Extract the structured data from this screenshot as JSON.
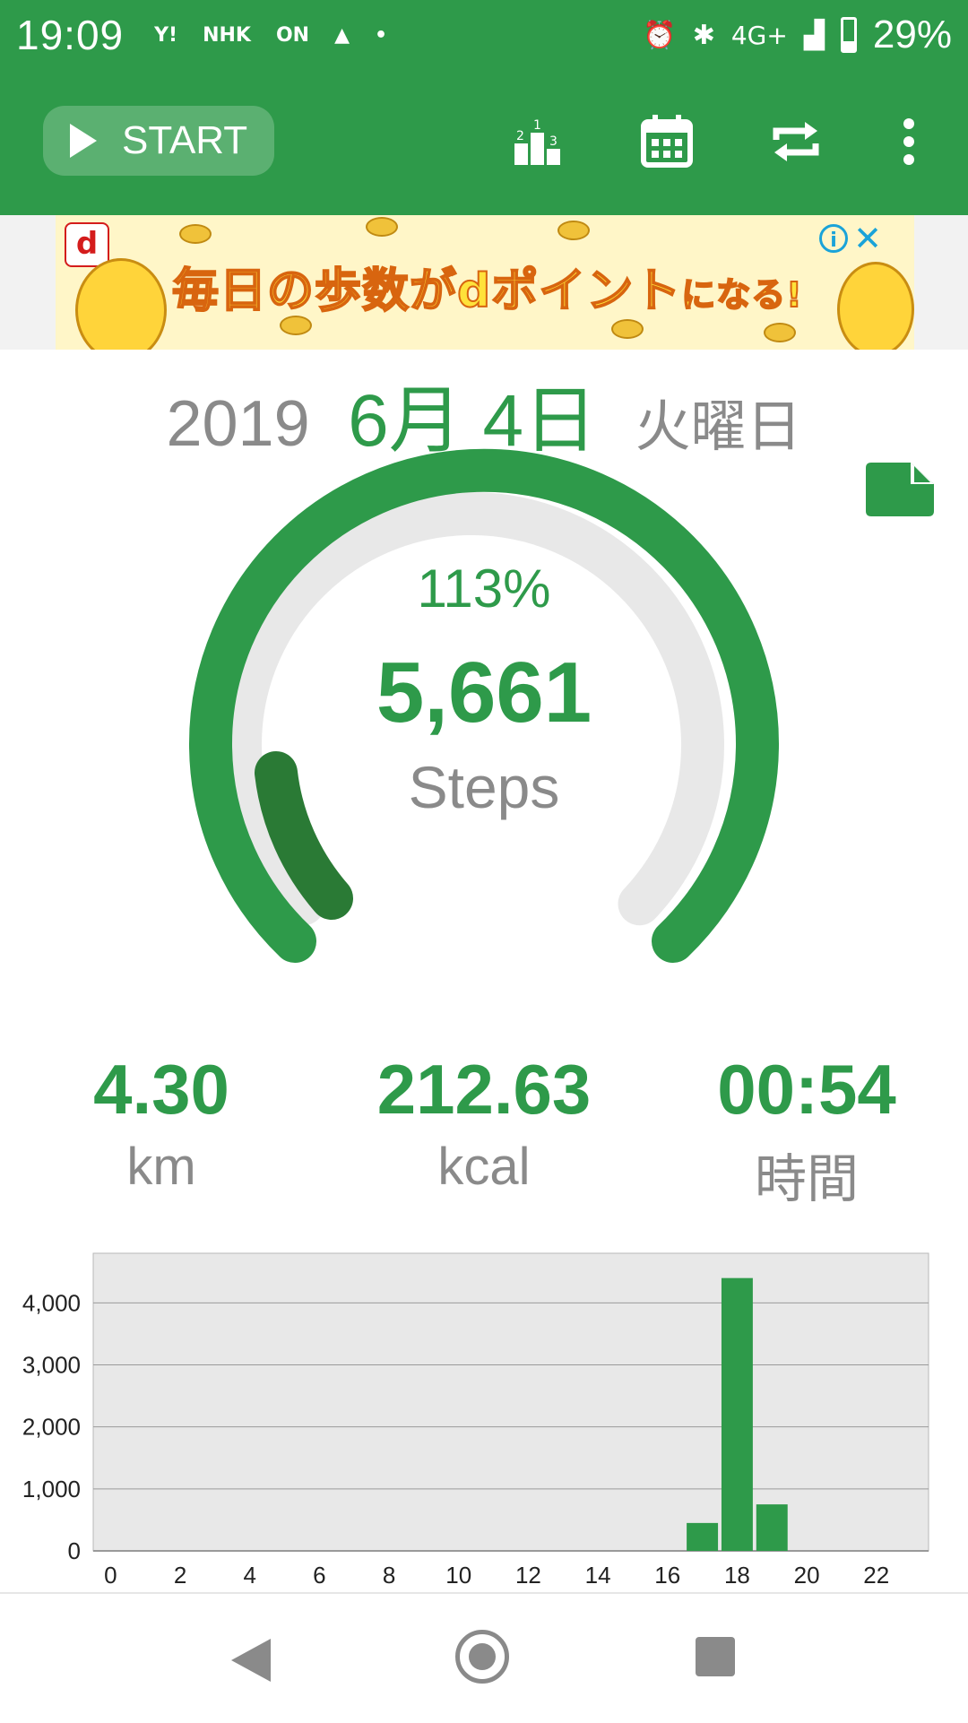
{
  "status_bar": {
    "time": "19:09",
    "left_icons": [
      "Y!",
      "NHK",
      "ON"
    ],
    "network": "4G+",
    "battery": "29%"
  },
  "app_bar": {
    "start_label": "START",
    "icons": [
      "ranking-icon",
      "calendar-icon",
      "repeat-icon",
      "more-icon"
    ]
  },
  "ad": {
    "headline": "毎日の歩数がdポイントになる!",
    "headline_part1": "毎日の歩数が",
    "headline_part2": "dポイント",
    "headline_part3": "になる!"
  },
  "date": {
    "year": "2019",
    "month_day": "6月 4日",
    "weekday": "火曜日"
  },
  "gauge": {
    "percent": "113%",
    "steps": "5,661",
    "steps_label": "Steps",
    "goal_fraction": 1.13
  },
  "stats": {
    "distance": {
      "value": "4.30",
      "unit": "km"
    },
    "calories": {
      "value": "212.63",
      "unit": "kcal"
    },
    "duration": {
      "value": "00:54",
      "unit": "時間"
    }
  },
  "chart_data": {
    "type": "bar",
    "x": [
      0,
      1,
      2,
      3,
      4,
      5,
      6,
      7,
      8,
      9,
      10,
      11,
      12,
      13,
      14,
      15,
      16,
      17,
      18,
      19,
      20,
      21,
      22,
      23
    ],
    "values": [
      0,
      0,
      0,
      0,
      0,
      0,
      0,
      0,
      0,
      0,
      0,
      0,
      0,
      0,
      0,
      0,
      0,
      450,
      4400,
      750,
      0,
      0,
      0,
      0
    ],
    "x_tick_labels": [
      "0",
      "2",
      "4",
      "6",
      "8",
      "10",
      "12",
      "14",
      "16",
      "18",
      "20",
      "22"
    ],
    "y_tick_labels": [
      "0",
      "1,000",
      "2,000",
      "3,000",
      "4,000"
    ],
    "ylim": [
      0,
      4800
    ],
    "grid": true,
    "bar_color": "#2e9a4a"
  },
  "colors": {
    "accent": "#2e9a4a",
    "accent_dark": "#2a7a35",
    "muted": "#8a8a8a",
    "track": "#e8e8e8"
  }
}
